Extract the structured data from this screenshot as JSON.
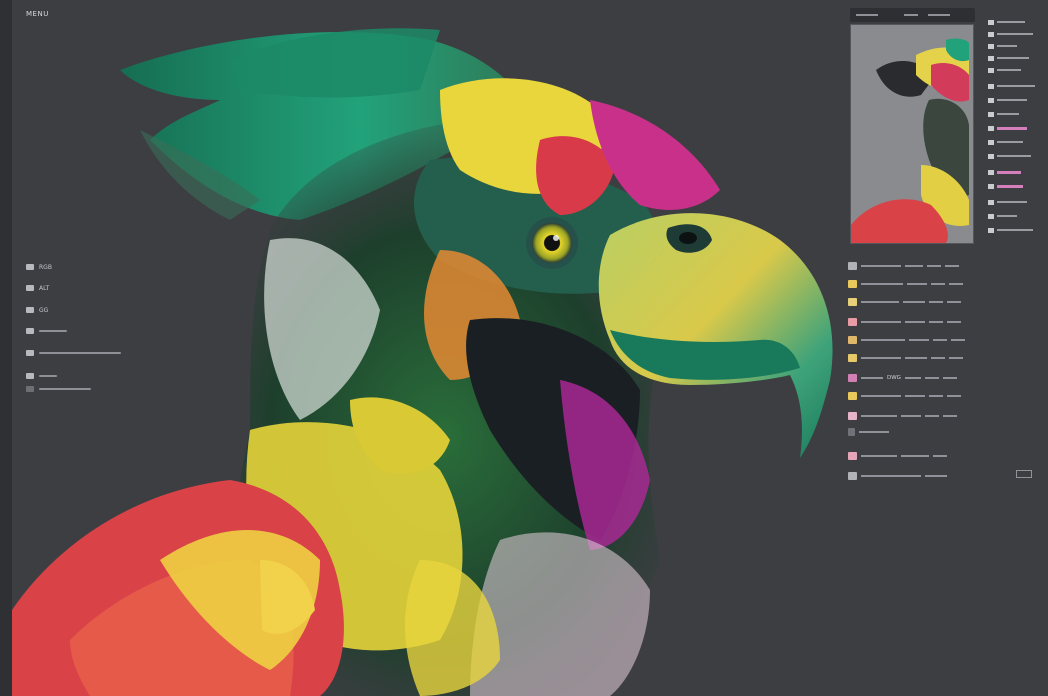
{
  "menu_tag": "MENU",
  "left_panel": {
    "rows": [
      {
        "label": "RGB",
        "line": 0
      },
      {
        "label": "ALT",
        "line": 0
      },
      {
        "label": "GG",
        "line": 0
      },
      {
        "label": "",
        "line": 28
      },
      {
        "label": "",
        "line": 82
      },
      {
        "label": "",
        "line": 18
      },
      {
        "label": "",
        "line": 52
      }
    ]
  },
  "layers": {
    "rows": [
      {
        "label": "",
        "thumb_color": "#b0b2b8"
      },
      {
        "label": "",
        "thumb_color": "#e8c85a"
      },
      {
        "label": "",
        "thumb_color": "#e8d07a"
      },
      {
        "label": "",
        "thumb_color": "#e89aa5"
      },
      {
        "label": "",
        "thumb_color": "#e0b86c"
      },
      {
        "label": "",
        "thumb_color": "#e7c96a"
      },
      {
        "label": "DWG",
        "thumb_color": "#d27fb6"
      },
      {
        "label": "",
        "thumb_color": "#e8c85a"
      },
      {
        "label": "",
        "thumb_color": "#e7b4c7"
      },
      {
        "label": "",
        "thumb_color": "#e5a4b8"
      },
      {
        "label": "",
        "thumb_color": "#b0b2b8"
      }
    ]
  },
  "colors": {
    "background": "#3d3e42",
    "feather_green": "#1f8f64",
    "feather_yellow": "#e9d53c",
    "feather_red": "#d93a4a",
    "feather_magenta": "#c8308a",
    "beak_yellow": "#c9d85c",
    "eye_yellow": "#e8d62a"
  },
  "icons": [
    "menu-icon",
    "layer-thumbnail-icon",
    "expand-icon"
  ]
}
